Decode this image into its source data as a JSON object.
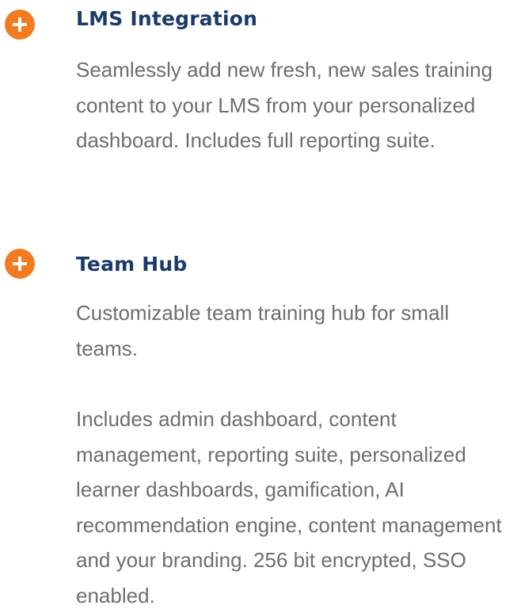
{
  "theme": {
    "accent": "#f47a1f",
    "title_color": "#1b3a6b",
    "text_color": "#6e6e6e"
  },
  "features": [
    {
      "icon": "plus-circle-icon",
      "title": "LMS Integration",
      "paragraphs": [
        "Seamlessly add new fresh, new sales training content to your LMS from your personalized dashboard. Includes full reporting suite."
      ]
    },
    {
      "icon": "plus-circle-icon",
      "title": "Team Hub",
      "paragraphs": [
        "Customizable team training hub for small teams.",
        "Includes admin dashboard, content management, reporting suite, personalized learner dashboards, gamification, AI recommendation engine, content management and your branding. 256 bit encrypted, SSO enabled."
      ]
    }
  ]
}
